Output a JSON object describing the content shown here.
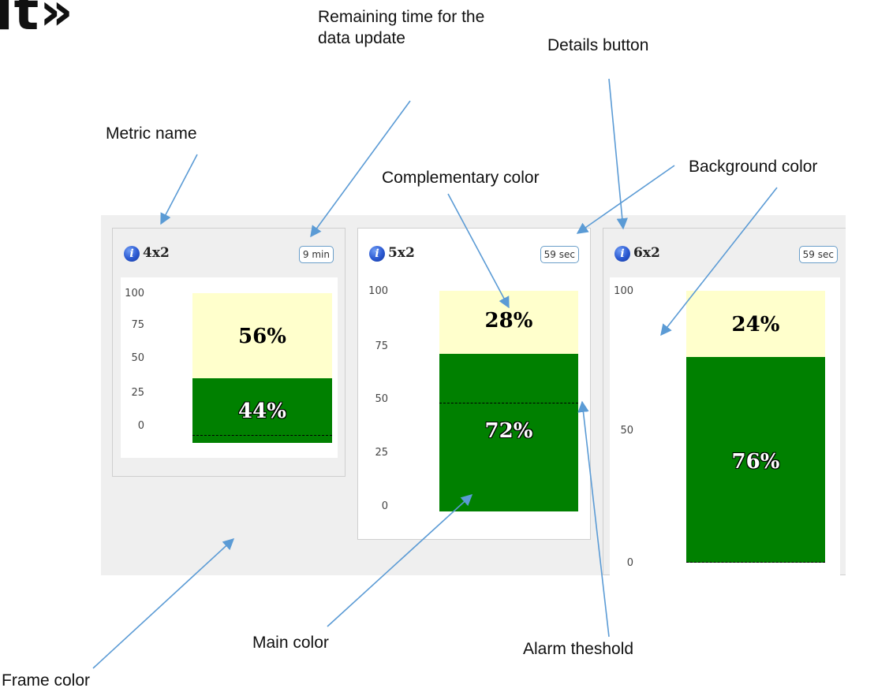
{
  "heading_fragment": "lt»",
  "widgets": [
    {
      "metric_name": "4x2",
      "timer": "9 min",
      "ticks": [
        "100",
        "75",
        "50",
        "25",
        "0"
      ],
      "main_pct": "44%",
      "complement_pct": "56%",
      "main_value": 44,
      "complement_value": 56,
      "threshold_value": 5
    },
    {
      "metric_name": "5x2",
      "timer": "59 sec",
      "ticks": [
        "100",
        "75",
        "50",
        "25",
        "0"
      ],
      "main_pct": "72%",
      "complement_pct": "28%",
      "main_value": 72,
      "complement_value": 28,
      "threshold_value": 50
    },
    {
      "metric_name": "6x2",
      "timer": "59 sec",
      "ticks": [
        "100",
        "50",
        "0"
      ],
      "main_pct": "76%",
      "complement_pct": "24%",
      "main_value": 76,
      "complement_value": 24,
      "threshold_value": 0
    }
  ],
  "annotations": {
    "remaining_time": "Remaining time for the data update",
    "details_button": "Details button",
    "metric_name": "Metric name",
    "complementary_color": "Complementary color",
    "background_color": "Background color",
    "main_color": "Main color",
    "alarm_threshold": "Alarm theshold",
    "frame_color": "Frame color"
  },
  "colors": {
    "frame": "#efefef",
    "background": "#ffffff",
    "main": "#008000",
    "complementary": "#ffffcc",
    "arrow": "#5b9bd5",
    "info_icon": "#2a58d0",
    "timer_border": "#6a9ec9"
  },
  "icons": {
    "info": "info-circle-icon"
  }
}
